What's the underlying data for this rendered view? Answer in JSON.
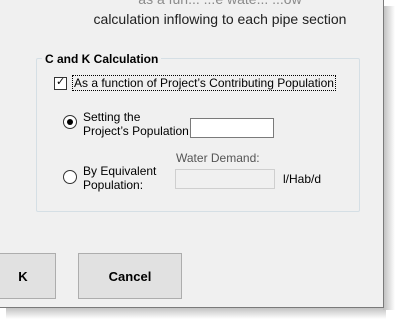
{
  "header": {
    "partial_line": "as a fun... ...e wate... ...ow",
    "line": "calculation inflowing to each pipe section"
  },
  "group": {
    "title": "C and K Calculation",
    "checkbox_label": "As a function of Project’s Contributing Population",
    "checked": true
  },
  "option_setting": {
    "line1": "Setting the",
    "line2": "Project’s Population:",
    "input_value": ""
  },
  "option_equivalent": {
    "line1": "By Equivalent",
    "line2": "Population:",
    "water_demand_label": "Water Demand:",
    "input_value": "",
    "unit": "l/Hab/d"
  },
  "buttons": {
    "ok_label": "K",
    "cancel_label": "Cancel"
  }
}
